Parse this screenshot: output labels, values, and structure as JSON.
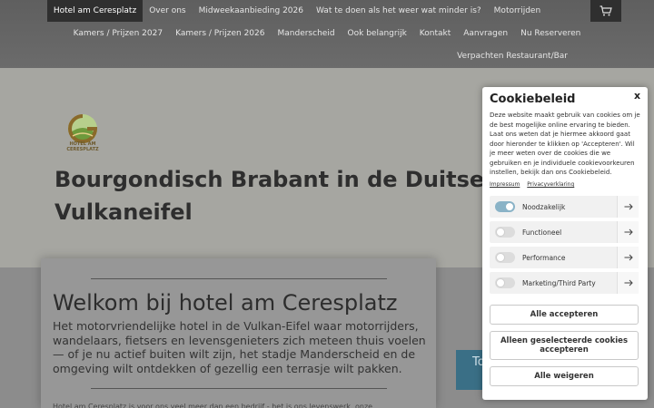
{
  "nav": {
    "row1": [
      "Hotel am Ceresplatz",
      "Over ons",
      "Midweekaanbieding 2026",
      "Wat te doen als het weer wat minder is?",
      "Motorrijden"
    ],
    "row2": [
      "Kamers / Prijzen 2027",
      "Kamers / Prijzen 2026",
      "Manderscheid",
      "Ook belangrijk",
      "Kontakt",
      "Aanvragen",
      "Nu Reserveren"
    ],
    "row3": [
      "Verpachten Restaurant/Bar"
    ]
  },
  "logo": {
    "line1": "HOTEL AM",
    "line2": "CERESPLATZ"
  },
  "hero": {
    "title": "Bourgondisch Brabant in de Duitse\nVulkaneifel"
  },
  "content": {
    "heading": "Welkom bij hotel am Ceresplatz",
    "subheading": "Het motorvriendelijke hotel in de Vulkan-Eifel waar motorrijders, wandelaars, fietsers en levensgenieters zich meteen thuis voelen — of je nu actief buiten wilt zijn, het stadje Manderscheid en de omgeving wilt ontdekken of gezellig een terrasje wilt pakken.",
    "body_partial": "Hotel am Ceresplatz is voor ons veel meer dan een bedrijf - het is ons levenswerk, onze",
    "side_button": "To"
  },
  "cookie": {
    "title": "Cookiebeleid",
    "close": "x",
    "description": "Deze website maakt gebruik van cookies om je de best mogelijke online ervaring te bieden. Laat ons weten dat je hiermee akkoord gaat door hieronder te klikken op 'Accepteren'. Wil je meer weten over de cookies die we gebruiken en je individuele cookievoorkeuren instellen, bekijk dan ons Cookiebeleid.",
    "links": [
      "Impressum",
      "Privacyverklaring"
    ],
    "categories": [
      {
        "label": "Noodzakelijk",
        "enabled": true
      },
      {
        "label": "Functioneel",
        "enabled": false
      },
      {
        "label": "Performance",
        "enabled": false
      },
      {
        "label": "Marketing/Third Party",
        "enabled": false
      }
    ],
    "buttons": {
      "accept_all": "Alle accepteren",
      "accept_selected": "Alleen geselecteerde cookies accepteren",
      "reject_all": "Alle weigeren"
    }
  },
  "colors": {
    "accent": "#3a6f86",
    "toggle_on": "#8ab3c7"
  }
}
